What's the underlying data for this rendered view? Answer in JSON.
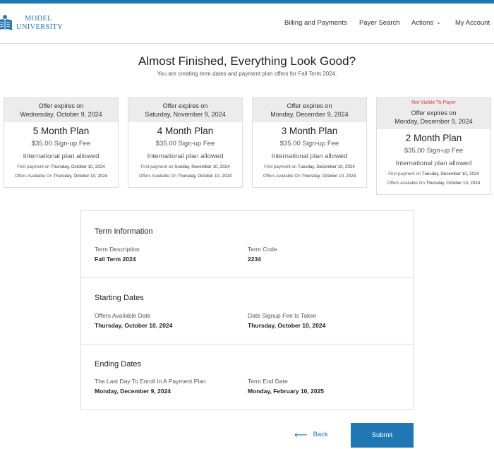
{
  "brand": {
    "line1": "MODEL",
    "line2": "UNIVERSITY",
    "color": "#2a78b9"
  },
  "nav": {
    "billing": "Billing and Payments",
    "payer_search": "Payer Search",
    "actions": "Actions",
    "my_account": "My Account"
  },
  "hero": {
    "title": "Almost Finished, Everything Look Good?",
    "subtitle": "You are creating term dates and payment plan offers for Fall Term 2024."
  },
  "cards": [
    {
      "warning": "",
      "expires_label": "Offer expires on",
      "expires_date": "Wednesday, October 9, 2024",
      "plan": "5 Month Plan",
      "fee": "$35.00 Sign-up Fee",
      "intl": "International plan allowed",
      "first_payment_label": "First payment on",
      "first_payment_date": "Thursday, October 10, 2024",
      "offers_label": "Offers Available On",
      "offers_date": "Thursday, October 10, 2024"
    },
    {
      "warning": "",
      "expires_label": "Offer expires on",
      "expires_date": "Saturday, November 9, 2024",
      "plan": "4 Month Plan",
      "fee": "$35.00 Sign-up Fee",
      "intl": "International plan allowed",
      "first_payment_label": "First payment on",
      "first_payment_date": "Sunday, November 10, 2024",
      "offers_label": "Offers Available On",
      "offers_date": "Thursday, October 10, 2024"
    },
    {
      "warning": "",
      "expires_label": "Offer expires on",
      "expires_date": "Monday, December 9, 2024",
      "plan": "3 Month Plan",
      "fee": "$35.00 Sign-up Fee",
      "intl": "International plan allowed",
      "first_payment_label": "First payment on",
      "first_payment_date": "Tuesday, December 10, 2024",
      "offers_label": "Offers Available On",
      "offers_date": "Thursday, October 10, 2024"
    },
    {
      "warning": "Not Visible To Payer",
      "expires_label": "Offer expires on",
      "expires_date": "Monday, December 9, 2024",
      "plan": "2 Month Plan",
      "fee": "$35.00 Sign-up Fee",
      "intl": "International plan allowed",
      "first_payment_label": "First payment on",
      "first_payment_date": "Tuesday, December 10, 2024",
      "offers_label": "Offers Available On",
      "offers_date": "Thursday, October 10, 2024"
    }
  ],
  "term_info": {
    "title": "Term Information",
    "desc_label": "Term Description",
    "desc_value": "Fall Term 2024",
    "code_label": "Term Code",
    "code_value": "2234"
  },
  "starting": {
    "title": "Starting Dates",
    "offers_label": "Offers Available Date",
    "offers_value": "Thursday, October 10, 2024",
    "signup_label": "Date Signup Fee Is Taken",
    "signup_value": "Thursday, October 10, 2024"
  },
  "ending": {
    "title": "Ending Dates",
    "enroll_label": "The Last Day To Enroll In A Payment Plan",
    "enroll_value": "Monday, December 9, 2024",
    "end_label": "Term End Date",
    "end_value": "Monday, February 10, 2025"
  },
  "actions": {
    "back": "Back",
    "submit": "Submit"
  },
  "colors": {
    "primary": "#1f78b4",
    "warning": "#d83a3a"
  }
}
